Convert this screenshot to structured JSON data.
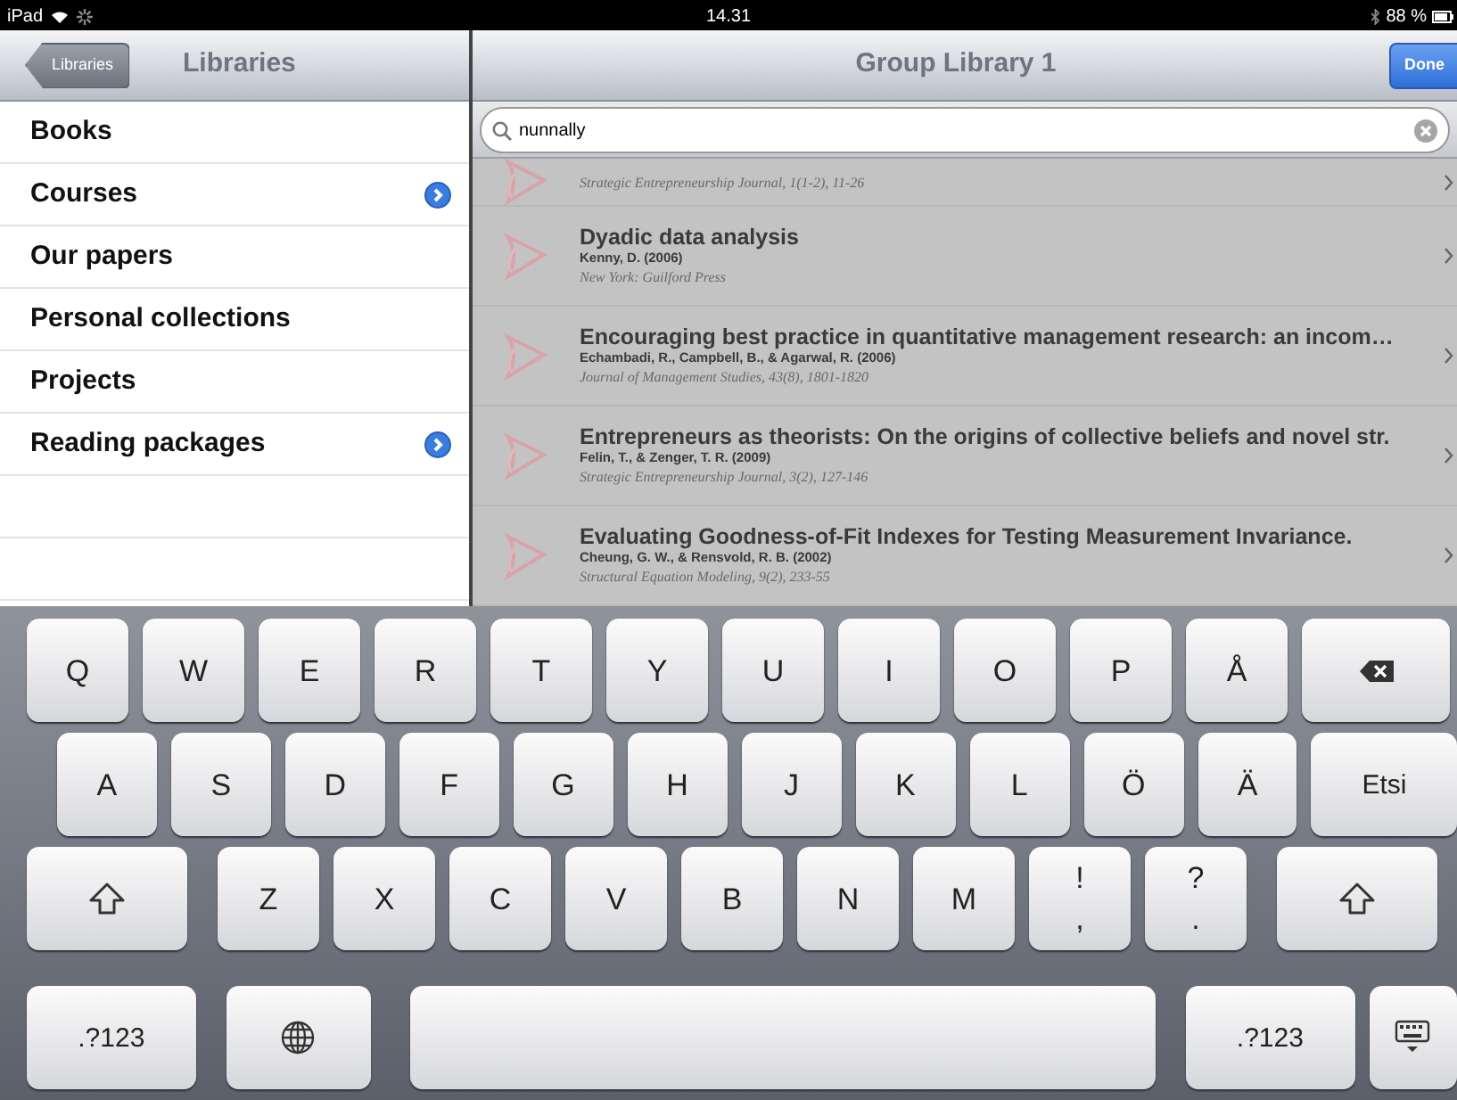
{
  "status_bar": {
    "carrier": "iPad",
    "time": "14.31",
    "battery": "88 %"
  },
  "sidebar": {
    "back_button": "Libraries",
    "title": "Libraries",
    "items": [
      {
        "label": "Books",
        "disclosure": false
      },
      {
        "label": "Courses",
        "disclosure": true
      },
      {
        "label": "Our papers",
        "disclosure": false
      },
      {
        "label": "Personal collections",
        "disclosure": false
      },
      {
        "label": "Projects",
        "disclosure": false
      },
      {
        "label": "Reading packages",
        "disclosure": true
      }
    ]
  },
  "main": {
    "title": "Group Library 1",
    "done_button": "Done",
    "search": {
      "value": "nunnally"
    },
    "results": [
      {
        "kind": "partial",
        "source": "Strategic Entrepreneurship Journal, 1(1-2), 11-26"
      },
      {
        "kind": "full",
        "title": "Dyadic data analysis",
        "authors": "Kenny, D. (2006)",
        "source": "New York: Guilford Press"
      },
      {
        "kind": "full",
        "title": "Encouraging best practice in quantitative management research: an incom…",
        "authors": "Echambadi, R., Campbell, B., & Agarwal, R. (2006)",
        "source": "Journal of Management Studies, 43(8), 1801-1820"
      },
      {
        "kind": "full",
        "title": "Entrepreneurs as theorists: On the origins of collective beliefs and novel str.",
        "authors": "Felin, T., & Zenger, T. R. (2009)",
        "source": "Strategic Entrepreneurship Journal, 3(2), 127-146"
      },
      {
        "kind": "full",
        "title": "Evaluating Goodness-of-Fit Indexes for Testing Measurement Invariance.",
        "authors": "Cheung, G. W., & Rensvold, R. B. (2002)",
        "source": "Structural Equation Modeling, 9(2), 233-55"
      }
    ]
  },
  "keyboard": {
    "rows": [
      [
        {
          "kind": "letter",
          "label": "Q"
        },
        {
          "kind": "letter",
          "label": "W"
        },
        {
          "kind": "letter",
          "label": "E"
        },
        {
          "kind": "letter",
          "label": "R"
        },
        {
          "kind": "letter",
          "label": "T"
        },
        {
          "kind": "letter",
          "label": "Y"
        },
        {
          "kind": "letter",
          "label": "U"
        },
        {
          "kind": "letter",
          "label": "I"
        },
        {
          "kind": "letter",
          "label": "O"
        },
        {
          "kind": "letter",
          "label": "P"
        },
        {
          "kind": "letter",
          "label": "Å"
        },
        {
          "kind": "backspace"
        }
      ],
      [
        {
          "kind": "letter",
          "label": "A"
        },
        {
          "kind": "letter",
          "label": "S"
        },
        {
          "kind": "letter",
          "label": "D"
        },
        {
          "kind": "letter",
          "label": "F"
        },
        {
          "kind": "letter",
          "label": "G"
        },
        {
          "kind": "letter",
          "label": "H"
        },
        {
          "kind": "letter",
          "label": "J"
        },
        {
          "kind": "letter",
          "label": "K"
        },
        {
          "kind": "letter",
          "label": "L"
        },
        {
          "kind": "letter",
          "label": "Ö"
        },
        {
          "kind": "letter",
          "label": "Ä"
        },
        {
          "kind": "return",
          "label": "Etsi"
        }
      ],
      [
        {
          "kind": "shift"
        },
        {
          "kind": "letter",
          "label": "Z"
        },
        {
          "kind": "letter",
          "label": "X"
        },
        {
          "kind": "letter",
          "label": "C"
        },
        {
          "kind": "letter",
          "label": "V"
        },
        {
          "kind": "letter",
          "label": "B"
        },
        {
          "kind": "letter",
          "label": "N"
        },
        {
          "kind": "letter",
          "label": "M"
        },
        {
          "kind": "dual",
          "label": "!",
          "sublabel": ","
        },
        {
          "kind": "dual",
          "label": "?",
          "sublabel": "."
        },
        {
          "kind": "shift"
        }
      ],
      [
        {
          "kind": "mode",
          "label": ".?123"
        },
        {
          "kind": "globe"
        },
        {
          "kind": "space"
        },
        {
          "kind": "mode",
          "label": ".?123"
        },
        {
          "kind": "hide"
        }
      ]
    ]
  }
}
